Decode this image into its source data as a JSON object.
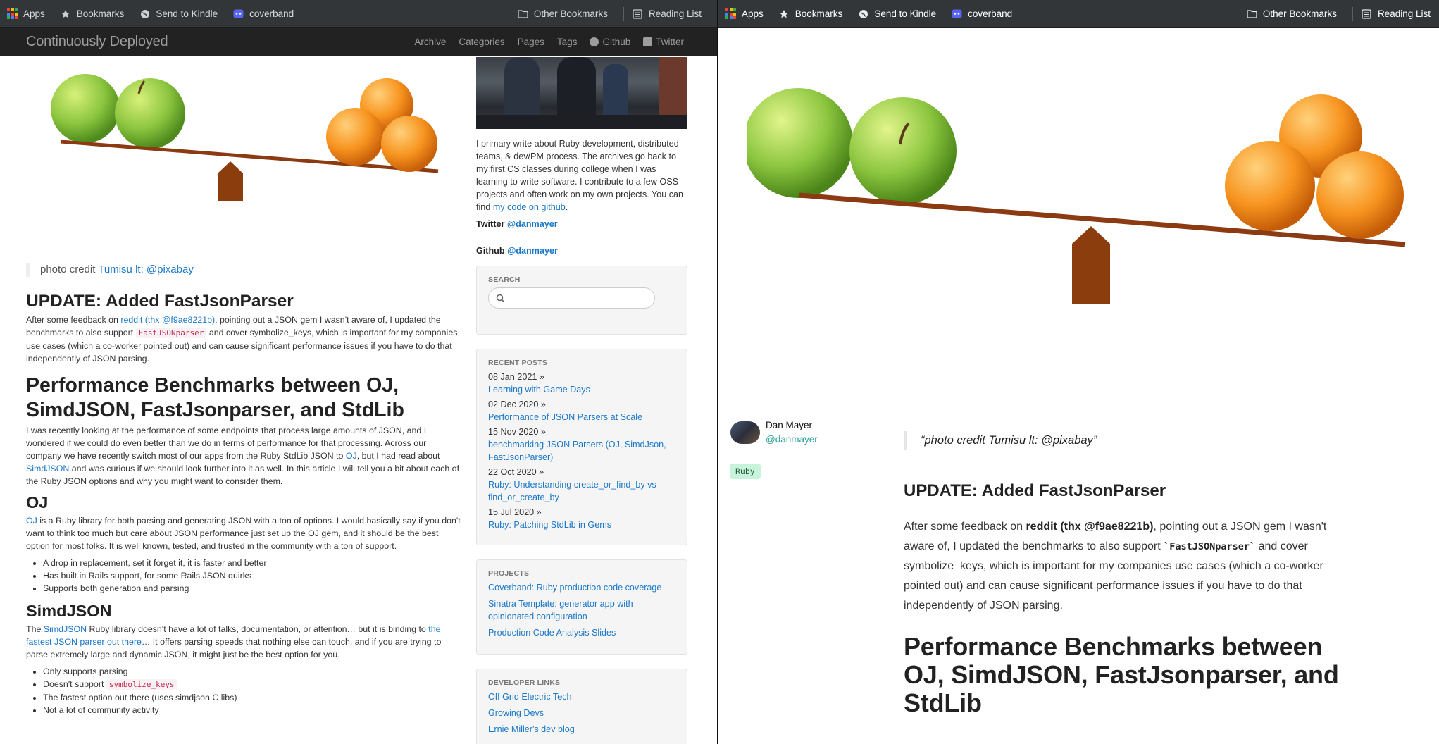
{
  "bookmarks": {
    "apps": "Apps",
    "bookmarks": "Bookmarks",
    "send_to_kindle": "Send to Kindle",
    "coverband": "coverband",
    "other_bookmarks": "Other Bookmarks",
    "reading_list": "Reading List"
  },
  "site": {
    "brand": "Continuously Deployed",
    "nav": [
      "Archive",
      "Categories",
      "Pages",
      "Tags",
      "Github",
      "Twitter"
    ]
  },
  "post": {
    "photo_credit_prefix": "photo credit ",
    "photo_credit_link": "Tumisu lt: @pixabay",
    "update_heading": "UPDATE: Added FastJsonParser",
    "update_p_1": "After some feedback on ",
    "update_link": "reddit (thx @f9ae8221b)",
    "update_p_2": ", pointing out a JSON gem I wasn't aware of, I updated the benchmarks to also support ",
    "update_code": "FastJSONparser",
    "update_p_3": " and cover symbolize_keys, which is important for my companies use cases (which a co-worker pointed out) and can cause significant performance issues if you have to do that independently of JSON parsing.",
    "main_heading": "Performance Benchmarks between OJ, SimdJSON, FastJsonparser, and StdLib",
    "intro_1": "I was recently looking at the performance of some endpoints that process large amounts of JSON, and I wondered if we could do even better than we do in terms of performance for that processing. Across our company we have recently switch most of our apps from the Ruby StdLib JSON to ",
    "intro_oj_link": "OJ",
    "intro_2": ", but I had read about ",
    "intro_simd_link": "SimdJSON",
    "intro_3": " and was curious if we should look further into it as well. In this article I will tell you a bit about each of the Ruby JSON options and why you might want to consider them.",
    "oj_heading": "OJ",
    "oj_link": "OJ",
    "oj_text": " is a Ruby library for both parsing and generating JSON with a ton of options. I would basically say if you don't want to think too much but care about JSON performance just set up the OJ gem, and it should be the best option for most folks. It is well known, tested, and trusted in the community with a ton of support.",
    "oj_bullets": [
      "A drop in replacement, set it forget it, it is faster and better",
      "Has built in Rails support, for some Rails JSON quirks",
      "Supports both generation and parsing"
    ],
    "simd_heading": "SimdJSON",
    "simd_1": "The ",
    "simd_link": "SimdJSON",
    "simd_2": " Ruby library doesn't have a lot of talks, documentation, or attention… but it is binding to ",
    "simd_fastest_link": "the fastest JSON parser out there",
    "simd_3": "… It offers parsing speeds that nothing else can touch, and if you are trying to parse extremely large and dynamic JSON, it might just be the best option for you.",
    "simd_bullets": {
      "b1": "Only supports parsing",
      "b2_prefix": "Doesn't support ",
      "b2_code": "symbolize_keys",
      "b3": "The fastest option out there (uses simdjson C libs)",
      "b4": "Not a lot of community activity"
    }
  },
  "sidebar": {
    "about": "I primary write about Ruby development, distributed teams, & dev/PM process. The archives go back to my first CS classes during college when I was learning to write software. I contribute to a few OSS projects and often work on my own projects. You can find ",
    "about_link": "my code on github",
    "about_end": ".",
    "twitter_label": "Twitter ",
    "twitter_handle": "@danmayer",
    "github_label": "Github ",
    "github_handle": "@danmayer",
    "search_title": "SEARCH",
    "recent_title": "RECENT POSTS",
    "recent_posts": [
      {
        "date": "08 Jan 2021 »",
        "title": "Learning with Game Days"
      },
      {
        "date": "02 Dec 2020 »",
        "title": "Performance of JSON Parsers at Scale"
      },
      {
        "date": "15 Nov 2020 »",
        "title": "benchmarking JSON Parsers (OJ, SimdJson, FastJsonParser)"
      },
      {
        "date": "22 Oct 2020 »",
        "title": "Ruby: Understanding create_or_find_by vs find_or_create_by"
      },
      {
        "date": "15 Jul 2020 »",
        "title": "Ruby: Patching StdLib in Gems"
      }
    ],
    "projects_title": "PROJECTS",
    "projects": [
      "Coverband: Ruby production code coverage",
      "Sinatra Template: generator app with opinionated configuration",
      "Production Code Analysis Slides"
    ],
    "dev_links_title": "DEVELOPER LINKS",
    "dev_links": [
      "Off Grid Electric Tech",
      "Growing Devs",
      "Ernie Miller's dev blog"
    ]
  },
  "reader": {
    "author_name": "Dan Mayer",
    "author_handle": "@danmayer",
    "tag": "Ruby",
    "quote_open": "“photo credit ",
    "quote_link": "Tumisu lt: @pixabay",
    "quote_close": "”",
    "update_heading": "UPDATE: Added FastJsonParser",
    "p1_a": "After some feedback on ",
    "p1_link": "reddit (thx @f9ae8221b)",
    "p1_b": ", pointing out a JSON gem I wasn't aware of, I updated the benchmarks to also support ",
    "p1_code": "`FastJSONparser`",
    "p1_c": " and cover symbolize_keys, which is important for my companies use cases (which a co-worker pointed out) and can cause significant performance issues if you have to do that independently of JSON parsing.",
    "main_heading": "Performance Benchmarks between OJ, SimdJSON, FastJsonparser, and StdLib"
  },
  "colors": {
    "link": "#1a77c9",
    "navbar": "#222222",
    "bookmark_bar": "#323639",
    "tag_bg": "#c6f3da",
    "handle": "#2aa198"
  }
}
